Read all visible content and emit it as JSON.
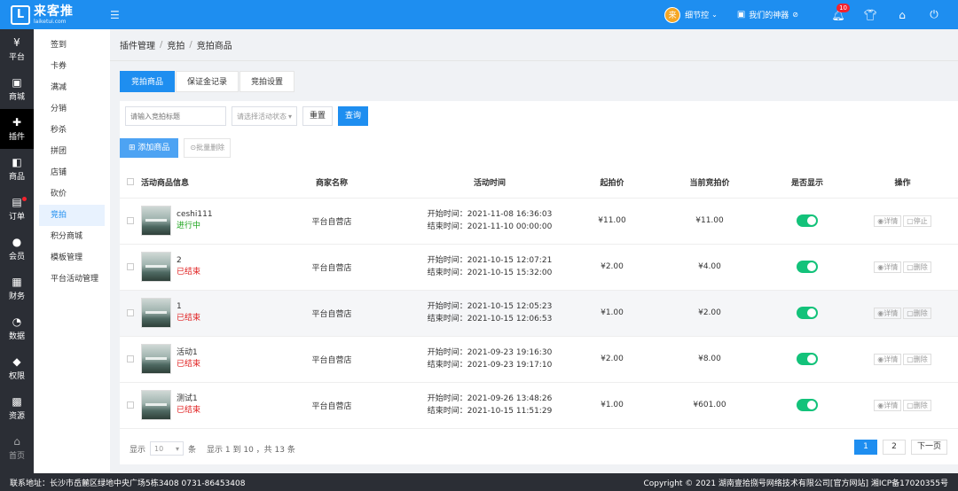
{
  "header": {
    "logo_mark": "L",
    "logo_name": "来客推",
    "logo_url": "laiketui.com",
    "menu_icon": "menu-icon",
    "user_avatar": "来",
    "user_name": "细节控",
    "shop_name": "我们的神器",
    "notification_count": "10",
    "icons": [
      "bell-icon",
      "shirt-icon",
      "shop-icon",
      "power-icon"
    ]
  },
  "nav1": [
    {
      "icon": "¥",
      "label": "平台"
    },
    {
      "icon": "▣",
      "label": "商城"
    },
    {
      "icon": "✚",
      "label": "插件"
    },
    {
      "icon": "◧",
      "label": "商品"
    },
    {
      "icon": "▤",
      "label": "订单"
    },
    {
      "icon": "●",
      "label": "会员"
    },
    {
      "icon": "▦",
      "label": "财务"
    },
    {
      "icon": "◔",
      "label": "数据"
    },
    {
      "icon": "◆",
      "label": "权限"
    },
    {
      "icon": "▩",
      "label": "资源"
    },
    {
      "icon": "⌂",
      "label": "首页"
    }
  ],
  "nav2": [
    "签到",
    "卡券",
    "满减",
    "分销",
    "秒杀",
    "拼团",
    "店铺",
    "砍价",
    "竞拍",
    "积分商城",
    "模板管理",
    "平台活动管理"
  ],
  "breadcrumb": [
    "插件管理",
    "竞拍",
    "竞拍商品"
  ],
  "tabs": [
    "竞拍商品",
    "保证金记录",
    "竞拍设置"
  ],
  "filter": {
    "title_placeholder": "请输入竞拍标题",
    "status_placeholder": "请选择活动状态",
    "reset_label": "重置",
    "search_label": "查询"
  },
  "actions": {
    "add_label": "添加商品",
    "batch_delete_label": "批量删除"
  },
  "table": {
    "headers": [
      "活动商品信息",
      "商家名称",
      "活动时间",
      "起拍价",
      "当前竞拍价",
      "是否显示",
      "操作"
    ],
    "rows": [
      {
        "name": "ceshi111",
        "status": "进行中",
        "merchant": "平台自营店",
        "start": "开始时间：2021-11-08 16:36:03",
        "end": "结束时间：2021-11-10 00:00:00",
        "start_price": "¥11.00",
        "current_price": "¥11.00",
        "op1": "详情",
        "op2": "停止"
      },
      {
        "name": "2",
        "status": "已结束",
        "merchant": "平台自营店",
        "start": "开始时间：2021-10-15 12:07:21",
        "end": "结束时间：2021-10-15 15:32:00",
        "start_price": "¥2.00",
        "current_price": "¥4.00",
        "op1": "详情",
        "op2": "删除"
      },
      {
        "name": "1",
        "status": "已结束",
        "merchant": "平台自营店",
        "start": "开始时间：2021-10-15 12:05:23",
        "end": "结束时间：2021-10-15 12:06:53",
        "start_price": "¥1.00",
        "current_price": "¥2.00",
        "op1": "详情",
        "op2": "删除"
      },
      {
        "name": "活动1",
        "status": "已结束",
        "merchant": "平台自营店",
        "start": "开始时间：2021-09-23 19:16:30",
        "end": "结束时间：2021-09-23 19:17:10",
        "start_price": "¥2.00",
        "current_price": "¥8.00",
        "op1": "详情",
        "op2": "删除"
      },
      {
        "name": "测试1",
        "status": "已结束",
        "merchant": "平台自营店",
        "start": "开始时间：2021-09-26 13:48:26",
        "end": "结束时间：2021-10-15 11:51:29",
        "start_price": "¥1.00",
        "current_price": "¥601.00",
        "op1": "详情",
        "op2": "删除"
      }
    ]
  },
  "pager": {
    "show_label": "显示",
    "page_size": "10",
    "unit_label": "条",
    "summary": "显示 1 到 10 ，共 13 条",
    "pages": [
      "1",
      "2"
    ],
    "next_label": "下一页"
  },
  "footer": {
    "address": "联系地址：长沙市岳麓区绿地中央广场5栋3408 0731-86453408",
    "copyright": "Copyright © 2021 湖南壹拾捌号网络技术有限公司[官方网站]  湘ICP备17020355号"
  }
}
